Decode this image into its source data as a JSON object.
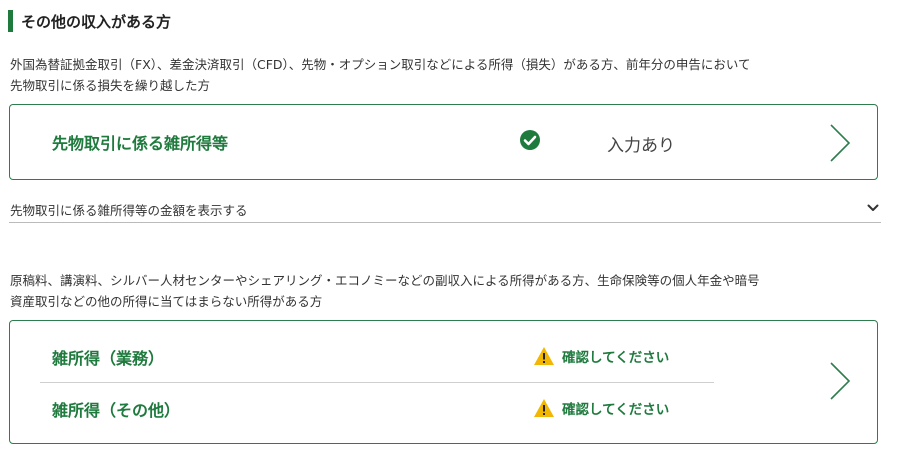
{
  "section": {
    "title": "その他の収入がある方"
  },
  "futures": {
    "description_line1": "外国為替証拠金取引（FX）、差金決済取引（CFD）、先物・オプション取引などによる所得（損失）がある方、前年分の申告において",
    "description_line2": "先物取引に係る損失を繰り越した方",
    "card": {
      "label": "先物取引に係る雑所得等",
      "status": "入力あり",
      "status_icon": "check-circle-icon"
    },
    "amount_toggle": {
      "label": "先物取引に係る雑所得等の金額を表示する",
      "icon": "chevron-down-icon"
    }
  },
  "misc": {
    "description_line1": "原稿料、講演料、シルバー人材センターやシェアリング・エコノミーなどの副収入による所得がある方、生命保険等の個人年金や暗号",
    "description_line2": "資産取引などの他の所得に当てはまらない所得がある方",
    "items": [
      {
        "label": "雑所得（業務）",
        "status": "確認してください",
        "status_icon": "warning-icon"
      },
      {
        "label": "雑所得（その他）",
        "status": "確認してください",
        "status_icon": "warning-icon"
      }
    ]
  },
  "colors": {
    "accent_green": "#1f7a3e",
    "border_green": "#2e7d4c",
    "warning_yellow": "#f2b705"
  }
}
